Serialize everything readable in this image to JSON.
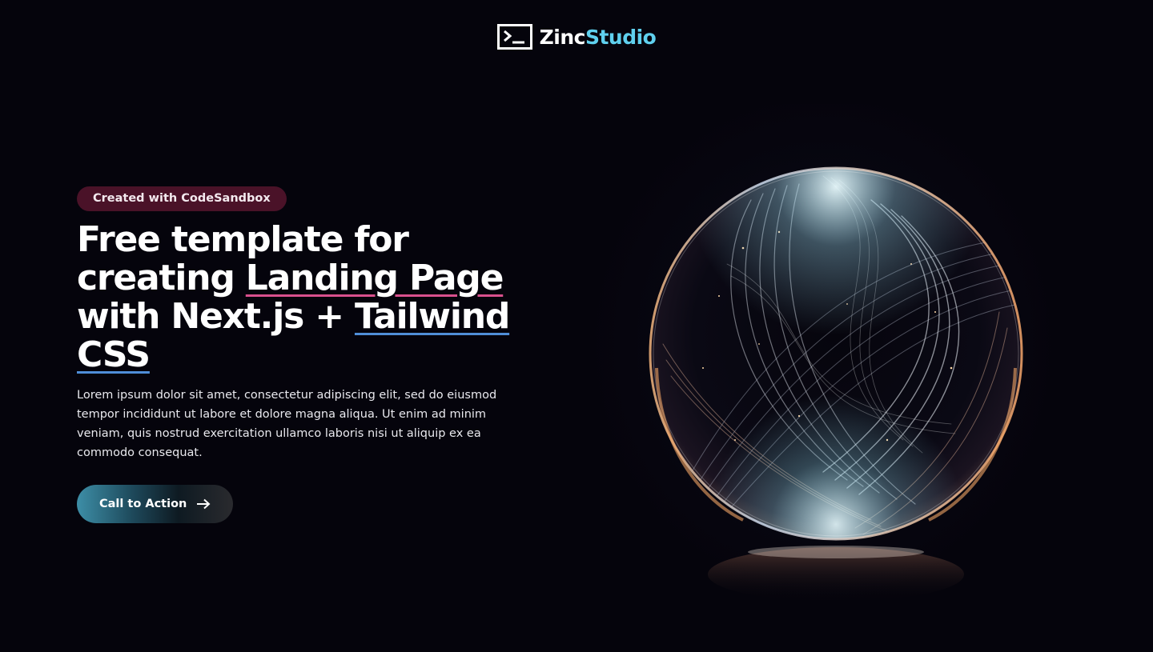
{
  "header": {
    "logo": {
      "icon": "terminal-icon",
      "name_part1": "Zinc",
      "name_part2": "Studio",
      "accent_color": "#5fd0ee"
    }
  },
  "hero": {
    "badge": "Created with CodeSandbox",
    "headline": {
      "part1": "Free template for creating ",
      "highlight1": "Landing Page",
      "part2": " with Next.js + ",
      "highlight2": "Tailwind CSS"
    },
    "description": "Lorem ipsum dolor sit amet, consectetur adipiscing elit, sed do eiusmod tempor incididunt ut labore et dolore magna aliqua. Ut enim ad minim veniam, quis nostrud exercitation ullamco laboris nisi ut aliquip ex ea commodo consequat.",
    "cta": {
      "label": "Call to Action",
      "icon": "arrow-right-icon"
    }
  },
  "illustration": {
    "name": "glass-sphere-illustration"
  },
  "colors": {
    "background": "#05040c",
    "badge_bg": "#4a1228",
    "underline_pink": "#d9508d",
    "underline_blue": "#4f8ed8",
    "cta_gradient_start": "#3d8ea7"
  }
}
